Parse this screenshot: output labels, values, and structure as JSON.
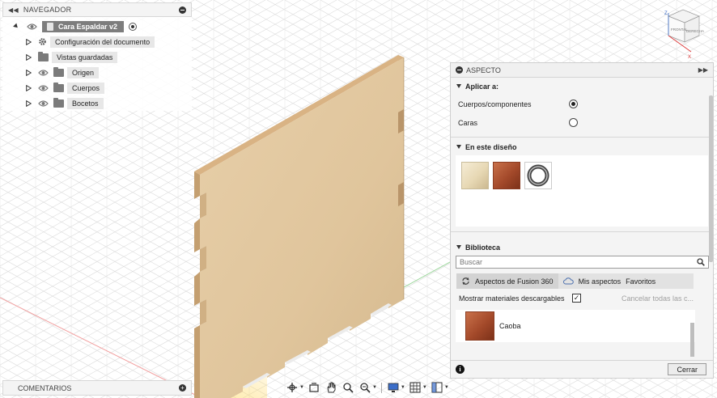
{
  "navigator": {
    "title": "NAVEGADOR",
    "root_label": "Cara Espaldar v2",
    "items": [
      {
        "label": "Configuración del documento",
        "icon": "gear-icon",
        "visible_toggle": false
      },
      {
        "label": "Vistas guardadas",
        "icon": "folder-icon",
        "visible_toggle": false
      },
      {
        "label": "Origen",
        "icon": "folder-icon",
        "visible_toggle": true
      },
      {
        "label": "Cuerpos",
        "icon": "folder-icon",
        "visible_toggle": true
      },
      {
        "label": "Bocetos",
        "icon": "folder-icon",
        "visible_toggle": true
      }
    ]
  },
  "comments": {
    "title": "COMENTARIOS"
  },
  "viewcube": {
    "front": "FRONTAL",
    "right": "DERECHA",
    "axis_x": "X",
    "axis_z": "Z"
  },
  "panel": {
    "title": "ASPECTO",
    "apply_section": "Aplicar a:",
    "apply_options": [
      {
        "label": "Cuerpos/componentes",
        "selected": true
      },
      {
        "label": "Caras",
        "selected": false
      }
    ],
    "design_section": "En este diseño",
    "design_swatches": [
      "oak-swatch",
      "mahogany-swatch",
      "chrome-ring-swatch"
    ],
    "library_section": "Biblioteca",
    "search_placeholder": "Buscar",
    "tabs": [
      "Aspectos de Fusion 360",
      "Mis aspectos",
      "Favoritos"
    ],
    "show_downloadable_label": "Mostrar materiales descargables",
    "show_downloadable_checked": true,
    "cancel_all": "Cancelar todas las c...",
    "materials": [
      {
        "name": "Caoba"
      }
    ],
    "close_button": "Cerrar"
  },
  "colors": {
    "wood_face": "#e2c9a3",
    "wood_edge": "#c9a574",
    "panel_bg": "#f4f4f4",
    "grid": "#d9d9d9"
  }
}
